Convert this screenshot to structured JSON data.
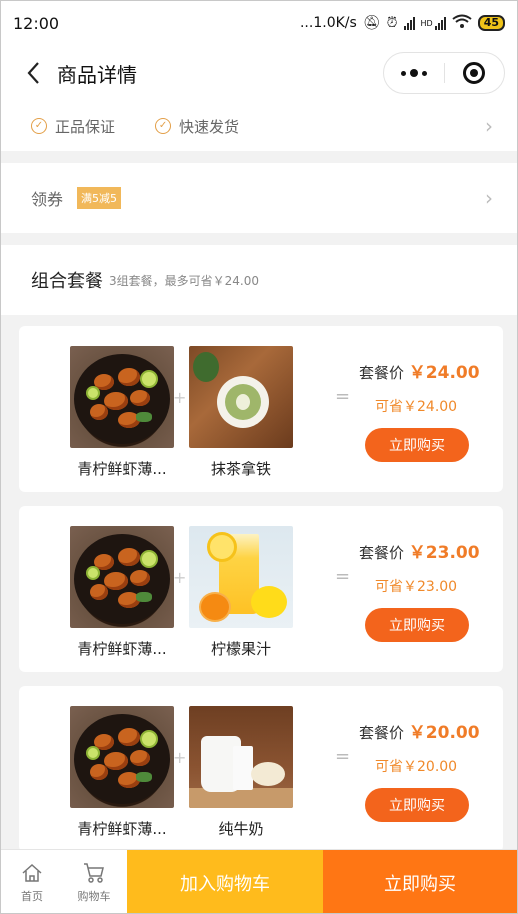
{
  "status_bar": {
    "time": "12:00",
    "net_speed": "...1.0K/s",
    "hd": "HD",
    "battery": "45"
  },
  "nav": {
    "title": "商品详情"
  },
  "guarantee": {
    "items": [
      {
        "label": "正品保证",
        "icon": "check-circle-icon"
      },
      {
        "label": "快速发货",
        "icon": "check-circle-icon"
      }
    ]
  },
  "coupon": {
    "label": "领券",
    "tag": "满5减5"
  },
  "package_section": {
    "title": "组合套餐",
    "subtitle": "3组套餐，最多可省￥24.00",
    "packages": [
      {
        "products": [
          {
            "name": "青柠鲜虾薄...",
            "image": "shrimp-dish"
          },
          {
            "name": "抹茶拿铁",
            "image": "matcha-latte"
          }
        ],
        "price_label": "套餐价",
        "price": "￥24.00",
        "save": "可省￥24.00",
        "buy_label": "立即购买"
      },
      {
        "products": [
          {
            "name": "青柠鲜虾薄...",
            "image": "shrimp-dish"
          },
          {
            "name": "柠檬果汁",
            "image": "lemon-juice"
          }
        ],
        "price_label": "套餐价",
        "price": "￥23.00",
        "save": "可省￥23.00",
        "buy_label": "立即购买"
      },
      {
        "products": [
          {
            "name": "青柠鲜虾薄...",
            "image": "shrimp-dish"
          },
          {
            "name": "纯牛奶",
            "image": "milk"
          }
        ],
        "price_label": "套餐价",
        "price": "￥20.00",
        "save": "可省￥20.00",
        "buy_label": "立即购买"
      }
    ]
  },
  "bottom_bar": {
    "home_label": "首页",
    "cart_label": "购物车",
    "add_cart_label": "加入购物车",
    "buy_now_label": "立即购买"
  },
  "colors": {
    "accent_orange": "#f3641c",
    "price_orange": "#f07c28",
    "add_cart_yellow": "#ffbb1c",
    "buy_now_orange": "#ff7614",
    "coupon_tag": "#f1b85a"
  }
}
